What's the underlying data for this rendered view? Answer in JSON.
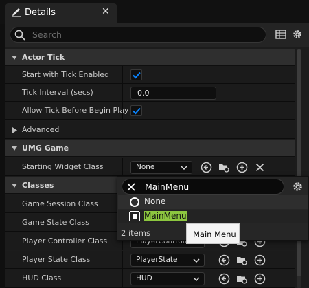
{
  "window": {
    "tab_title": "Details",
    "close_glyph": "✕",
    "tab_icon": "pencil-icon"
  },
  "search": {
    "placeholder": "Search",
    "icon": "search-icon",
    "tools": [
      "table-view-icon",
      "settings-gear-icon"
    ]
  },
  "categories": [
    {
      "label": "Actor Tick",
      "expanded": true
    },
    {
      "label": "Advanced",
      "expanded": false
    },
    {
      "label": "UMG Game",
      "expanded": true
    },
    {
      "label": "Classes",
      "expanded": true
    }
  ],
  "properties": {
    "start_with_tick": {
      "label": "Start with Tick Enabled",
      "checked": true
    },
    "tick_interval": {
      "label": "Tick Interval (secs)",
      "value": "0.0"
    },
    "allow_tick": {
      "label": "Allow Tick Before Begin Play",
      "checked": true
    },
    "starting_widget": {
      "label": "Starting Widget Class",
      "value": "None"
    },
    "game_session": {
      "label": "Game Session Class"
    },
    "game_state": {
      "label": "Game State Class"
    },
    "player_controller": {
      "label": "Player Controller Class",
      "value": "PlayerControll"
    },
    "player_state": {
      "label": "Player State Class",
      "value": "PlayerState"
    },
    "hud": {
      "label": "HUD Class",
      "value": "HUD"
    }
  },
  "class_picker": {
    "search_value": "MainMenu",
    "options": [
      {
        "label": "None",
        "icon": "none-circle-icon"
      },
      {
        "label": "MainMenu",
        "icon": "widget-blueprint-icon",
        "highlight": true
      }
    ],
    "count": "2 items"
  },
  "tooltip": {
    "text": "Main Menu"
  },
  "colors": {
    "accent": "#0070e0",
    "highlight": "#8cc63f",
    "selected_row": "#2e2e2e"
  }
}
